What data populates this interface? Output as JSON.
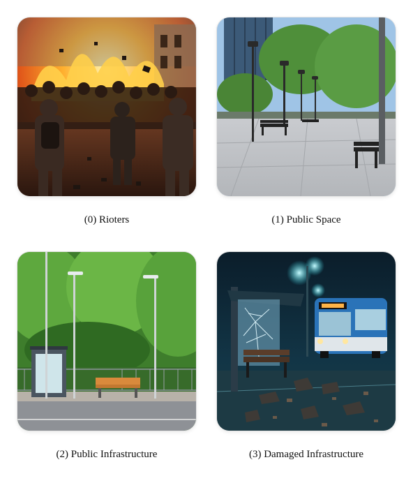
{
  "panels": [
    {
      "caption": "(0) Rioters"
    },
    {
      "caption": "(1) Public Space"
    },
    {
      "caption": "(2) Public Infrastructure"
    },
    {
      "caption": "(3) Damaged Infrastructure"
    }
  ],
  "colors": {
    "background": "#ffffff",
    "caption_text": "#111111"
  }
}
